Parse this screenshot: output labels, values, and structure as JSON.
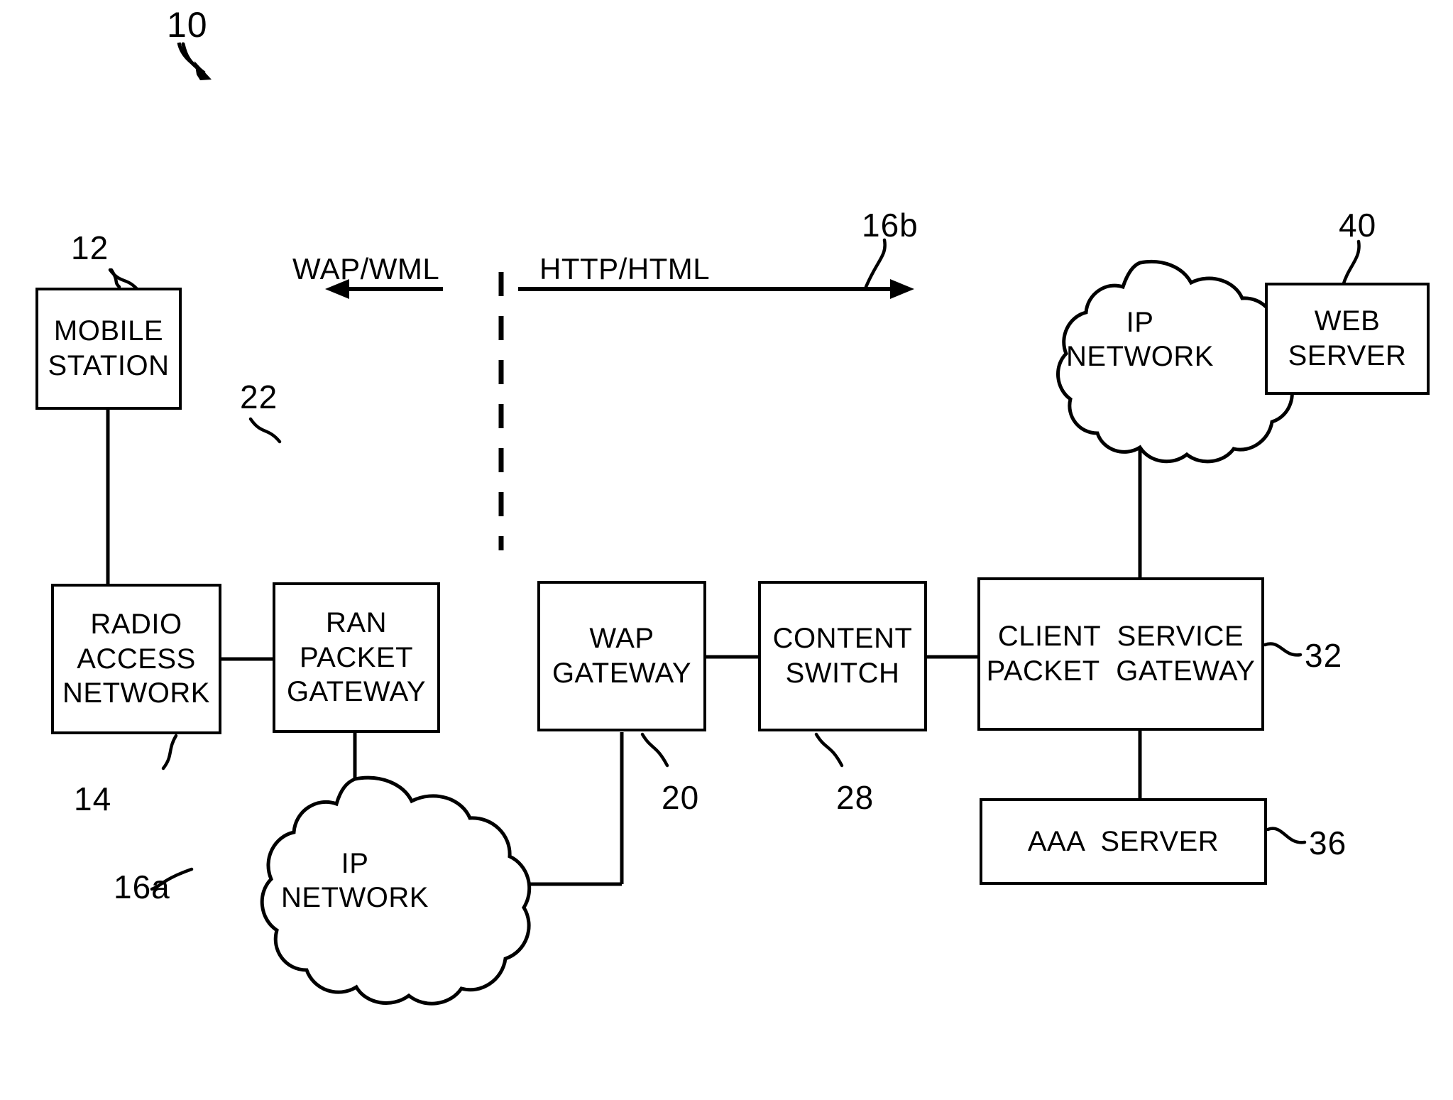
{
  "figure": {
    "figure_ref": "10",
    "boundary_divider": "dashed-vertical-line"
  },
  "nodes": [
    {
      "id": "mobile-station",
      "lines": [
        "MOBILE",
        "STATION"
      ],
      "ref": "12",
      "shape": "box"
    },
    {
      "id": "radio-access-network",
      "lines": [
        "RADIO",
        "ACCESS",
        "NETWORK"
      ],
      "ref": "14",
      "shape": "box"
    },
    {
      "id": "ran-packet-gateway",
      "lines": [
        "RAN",
        "PACKET",
        "GATEWAY"
      ],
      "ref": "22",
      "shape": "box"
    },
    {
      "id": "ip-network-a",
      "lines": [
        "IP",
        "NETWORK"
      ],
      "ref": "16a",
      "shape": "cloud"
    },
    {
      "id": "wap-gateway",
      "lines": [
        "WAP",
        "GATEWAY"
      ],
      "ref": "20",
      "shape": "box"
    },
    {
      "id": "content-switch",
      "lines": [
        "CONTENT",
        "SWITCH"
      ],
      "ref": "28",
      "shape": "box"
    },
    {
      "id": "client-service-packet-gateway",
      "lines": [
        "CLIENT  SERVICE",
        "PACKET  GATEWAY"
      ],
      "ref": "32",
      "shape": "box"
    },
    {
      "id": "aaa-server",
      "lines": [
        "AAA  SERVER"
      ],
      "ref": "36",
      "shape": "box"
    },
    {
      "id": "ip-network-b",
      "lines": [
        "IP",
        "NETWORK"
      ],
      "ref": "16b",
      "shape": "cloud"
    },
    {
      "id": "web-server",
      "lines": [
        "WEB",
        "SERVER"
      ],
      "ref": "40",
      "shape": "box"
    }
  ],
  "flow_arrows": [
    {
      "id": "wap-wml",
      "label": "WAP/WML",
      "direction": "left"
    },
    {
      "id": "http-html",
      "label": "HTTP/HTML",
      "direction": "right"
    }
  ],
  "labels": {
    "mobile_station_l1": "MOBILE",
    "mobile_station_l2": "STATION",
    "radio_access_l1": "RADIO",
    "radio_access_l2": "ACCESS",
    "radio_access_l3": "NETWORK",
    "ran_pgw_l1": "RAN",
    "ran_pgw_l2": "PACKET",
    "ran_pgw_l3": "GATEWAY",
    "ip_net_a_l1": "IP",
    "ip_net_a_l2": "NETWORK",
    "wap_gw_l1": "WAP",
    "wap_gw_l2": "GATEWAY",
    "content_switch_l1": "CONTENT",
    "content_switch_l2": "SWITCH",
    "cspgw_l1": "CLIENT  SERVICE",
    "cspgw_l2": "PACKET  GATEWAY",
    "aaa_server_l1": "AAA  SERVER",
    "ip_net_b_l1": "IP",
    "ip_net_b_l2": "NETWORK",
    "web_server_l1": "WEB",
    "web_server_l2": "SERVER",
    "wap_wml_arrow": "WAP/WML",
    "http_html_arrow": "HTTP/HTML"
  },
  "ref_numbers": {
    "figure": "10",
    "mobile_station": "12",
    "radio_access_network": "14",
    "ip_network_a": "16a",
    "ip_network_b": "16b",
    "wap_gateway": "20",
    "ran_packet_gateway": "22",
    "content_switch": "28",
    "client_service_packet_gateway": "32",
    "aaa_server": "36",
    "web_server": "40"
  },
  "colors": {
    "ink": "#000000",
    "paper": "#ffffff"
  }
}
